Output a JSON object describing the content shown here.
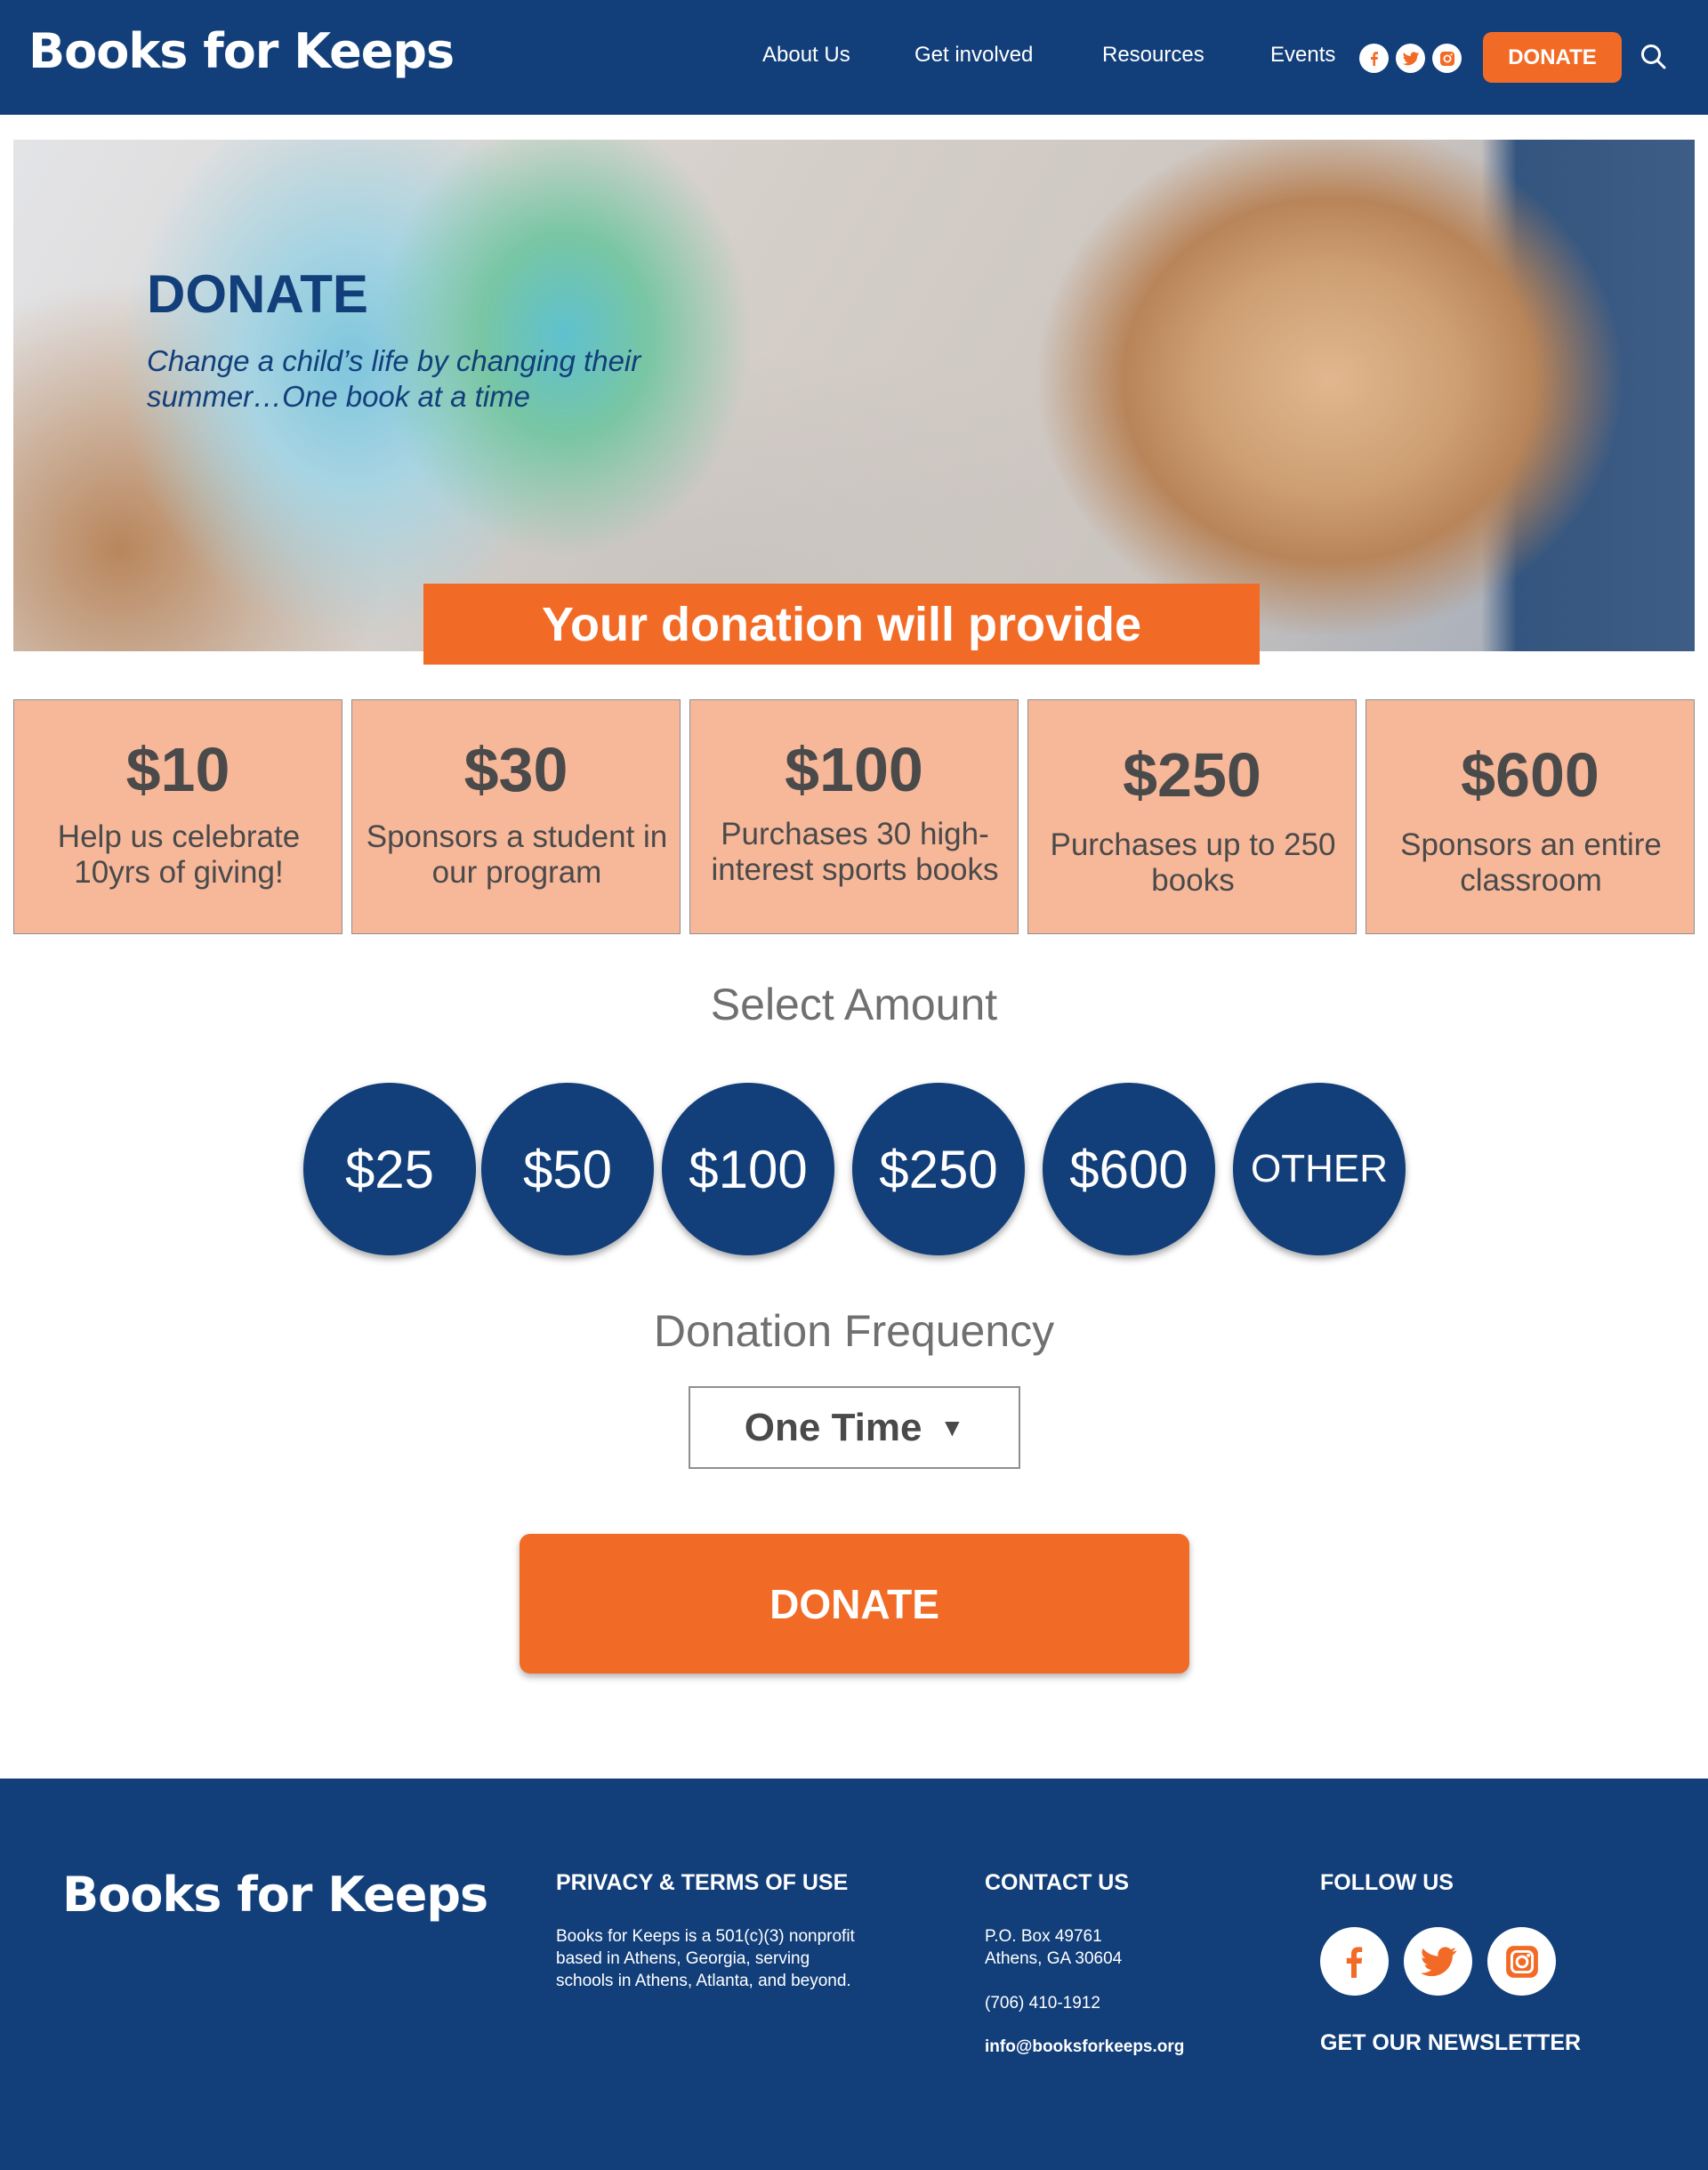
{
  "header": {
    "logo": "Books for Keeps",
    "nav": [
      "About Us",
      "Get involved",
      "Resources",
      "Events"
    ],
    "social_icons": [
      "facebook-icon",
      "twitter-icon",
      "instagram-icon"
    ],
    "donate_label": "DONATE",
    "search_icon": "search-icon"
  },
  "hero": {
    "title": "DONATE",
    "subtitle": "Change a child’s life by changing their summer…One book at a time",
    "banner": "Your donation will provide"
  },
  "tiers": [
    {
      "amount": "$10",
      "description": "Help us celebrate 10yrs of giving!"
    },
    {
      "amount": "$30",
      "description": "Sponsors a student in our program"
    },
    {
      "amount": "$100",
      "description": "Purchases 30 high-interest sports books"
    },
    {
      "amount": "$250",
      "description": "Purchases up to 250 books"
    },
    {
      "amount": "$600",
      "description": "Sponsors an entire classroom"
    }
  ],
  "select_amount": {
    "heading": "Select Amount",
    "options": [
      "$25",
      "$50",
      "$100",
      "$250",
      "$600",
      "OTHER"
    ]
  },
  "frequency": {
    "heading": "Donation Frequency",
    "selected": "One Time"
  },
  "donate_button": "DONATE",
  "footer": {
    "logo": "Books for Keeps",
    "privacy_heading": "PRIVACY & TERMS OF USE",
    "about_text": "Books for Keeps is a 501(c)(3) nonprofit based in Athens, Georgia, serving schools in Athens, Atlanta, and beyond.",
    "contact_heading": "CONTACT US",
    "address_line1": "P.O. Box 49761",
    "address_line2": "Athens, GA 30604",
    "phone": "(706) 410-1912",
    "email": "info@booksforkeeps.org",
    "follow_heading": "FOLLOW US",
    "newsletter": "GET OUR NEWSLETTER"
  },
  "colors": {
    "navy": "#123f7a",
    "orange": "#f26b26",
    "peach": "#f7b799",
    "text_gray": "#4a4a4a"
  }
}
